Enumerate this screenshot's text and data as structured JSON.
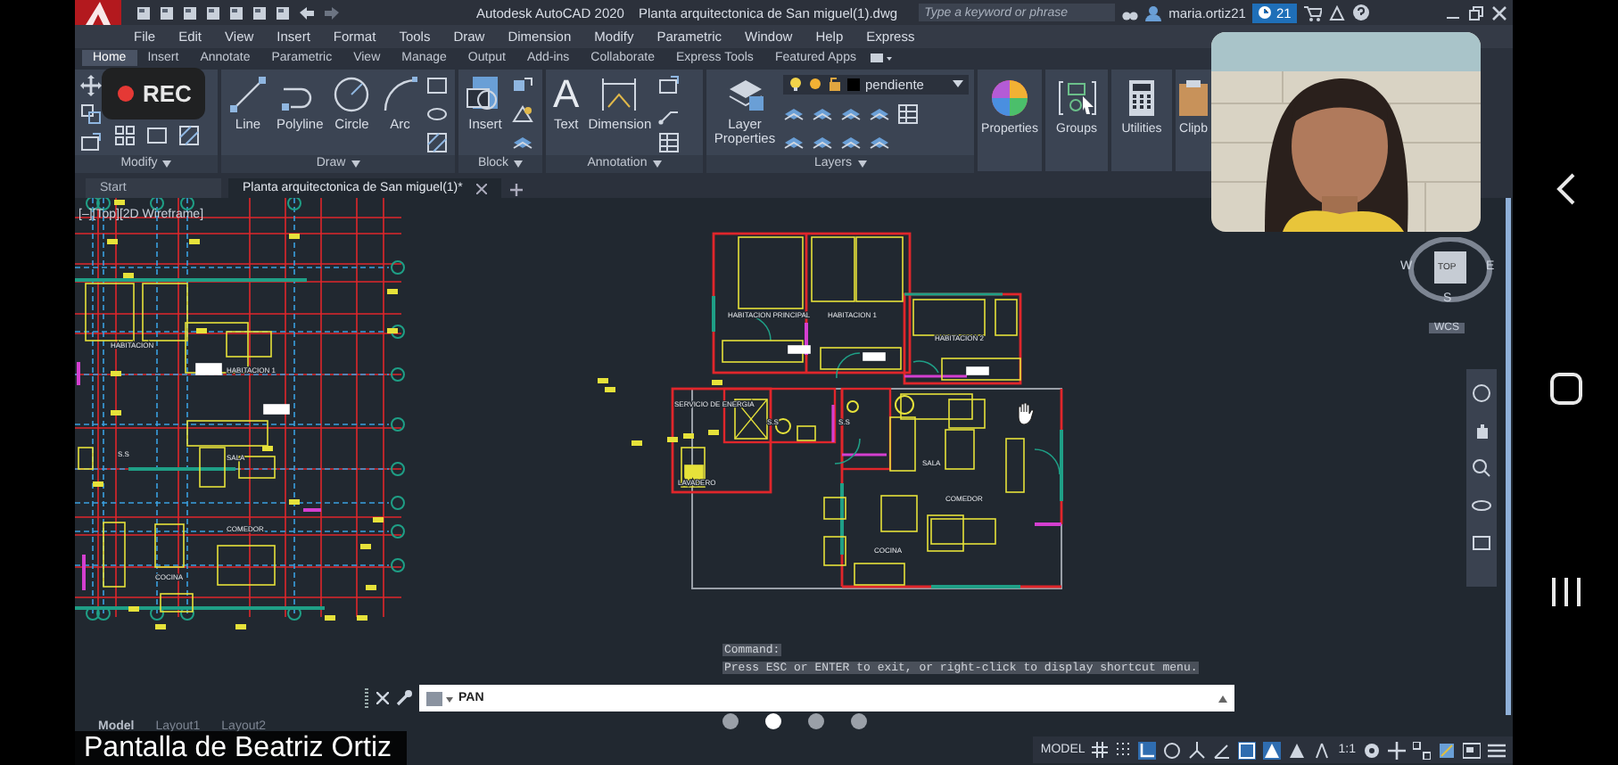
{
  "title_bar": {
    "app_title": "Autodesk AutoCAD 2020",
    "file_title": "Planta arquitectonica de San miguel(1).dwg",
    "search": {
      "placeholder": "Type a keyword or phrase"
    },
    "user": "maria.ortiz21",
    "notifications": "21"
  },
  "menu": [
    "File",
    "Edit",
    "View",
    "Insert",
    "Format",
    "Tools",
    "Draw",
    "Dimension",
    "Modify",
    "Parametric",
    "Window",
    "Help",
    "Express"
  ],
  "ribbon_tabs": [
    {
      "label": "Home",
      "selected": true
    },
    {
      "label": "Insert",
      "selected": false
    },
    {
      "label": "Annotate",
      "selected": false
    },
    {
      "label": "Parametric",
      "selected": false
    },
    {
      "label": "View",
      "selected": false
    },
    {
      "label": "Manage",
      "selected": false
    },
    {
      "label": "Output",
      "selected": false
    },
    {
      "label": "Add-ins",
      "selected": false
    },
    {
      "label": "Collaborate",
      "selected": false
    },
    {
      "label": "Express Tools",
      "selected": false
    },
    {
      "label": "Featured Apps",
      "selected": false
    }
  ],
  "ribbon_panels": [
    {
      "title": "Modify"
    },
    {
      "title": "Draw",
      "tools": [
        {
          "label": "Line"
        },
        {
          "label": "Polyline"
        },
        {
          "label": "Circle"
        },
        {
          "label": "Arc"
        }
      ]
    },
    {
      "title": "Block",
      "tools": [
        {
          "label": "Insert"
        }
      ]
    },
    {
      "title": "Annotation",
      "tools": [
        {
          "label": "Text",
          "glyph": "A"
        },
        {
          "label": "Dimension"
        }
      ]
    },
    {
      "title": "Layers",
      "tools": [
        {
          "label": "Layer Properties"
        }
      ],
      "layer": "pendiente"
    }
  ],
  "ribbon_buttons": [
    "Properties",
    "Groups",
    "Utilities",
    "Clipb"
  ],
  "doc_tabs": [
    {
      "label": "Start",
      "selected": false
    },
    {
      "label": "Planta arquitectonica de San miguel(1)*",
      "selected": true
    }
  ],
  "viewport_label": "[–][Top][2D Wireframe]",
  "plan_labels": [
    "HABITACION",
    "HABITACION 1",
    "S.S",
    "SALA",
    "COMEDOR",
    "COCINA",
    "HABITACION PRINCIPAL",
    "HABITACION 1",
    "HABITACION 2",
    "SERVICIO DE ENERGIA",
    "S.S",
    "S.S",
    "SALA",
    "LAVADERO",
    "COMEDOR",
    "COCINA"
  ],
  "viewcube": {
    "face": "TOP",
    "west": "W",
    "east": "E",
    "south": "S",
    "ucs": "WCS"
  },
  "command": {
    "history": [
      "Command:",
      "Press ESC or ENTER to exit, or right-click to display shortcut menu."
    ],
    "input": "PAN"
  },
  "layout_tabs": [
    {
      "label": "Model",
      "selected": true
    },
    {
      "label": "Layout1",
      "selected": false
    },
    {
      "label": "Layout2",
      "selected": false
    }
  ],
  "status_bar": {
    "mode": "MODEL",
    "scale": "1:1"
  },
  "recording": {
    "label": "REC"
  },
  "video": {
    "kind": "picture"
  },
  "caption": "Pantalla de Beatriz Ortiz",
  "pager": [
    {
      "selected": false
    },
    {
      "selected": true
    },
    {
      "selected": false
    },
    {
      "selected": false
    }
  ]
}
